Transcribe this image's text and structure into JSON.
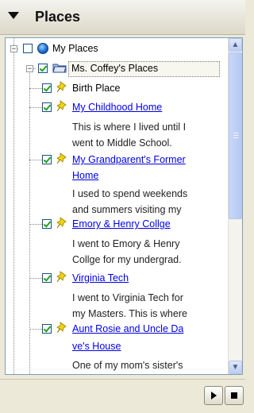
{
  "panel": {
    "title": "Places"
  },
  "tree": {
    "root": {
      "label": "My Places",
      "expander": "−",
      "checked": false
    },
    "folder": {
      "label": "Ms. Coffey's Places",
      "expander": "−",
      "checked": true
    },
    "items": [
      {
        "title": "Birth Place",
        "is_link": false,
        "checked": true,
        "desc": []
      },
      {
        "title": "My Childhood Home",
        "is_link": true,
        "checked": true,
        "desc": [
          "This is where I lived until I",
          "went to Middle School."
        ]
      },
      {
        "title_lines": [
          "My Grandparent's Former",
          "Home"
        ],
        "is_link": true,
        "checked": true,
        "desc": [
          "I used to spend weekends",
          "and summers visiting my"
        ]
      },
      {
        "title": "Emory & Henry Collge",
        "is_link": true,
        "checked": true,
        "desc": [
          "I went to Emory & Henry",
          "Collge for my undergrad."
        ]
      },
      {
        "title": "Virginia Tech",
        "is_link": true,
        "checked": true,
        "desc": [
          "I went to Virginia Tech for",
          "my Masters. This is where"
        ]
      },
      {
        "title_lines": [
          "Aunt Rosie and Uncle Da",
          "ve's House"
        ],
        "is_link": true,
        "checked": true,
        "desc": [
          "One of my mom's sister's"
        ]
      }
    ]
  },
  "scrollbar": {
    "up_arrow": "▲",
    "down_arrow": "▼",
    "position_fraction": 0.0
  },
  "footer": {
    "play_icon": "play-icon",
    "stop_icon": "stop-icon"
  },
  "colors": {
    "link": "#0000ee",
    "checkmark": "#21a121",
    "pin": "#f2d40c"
  }
}
